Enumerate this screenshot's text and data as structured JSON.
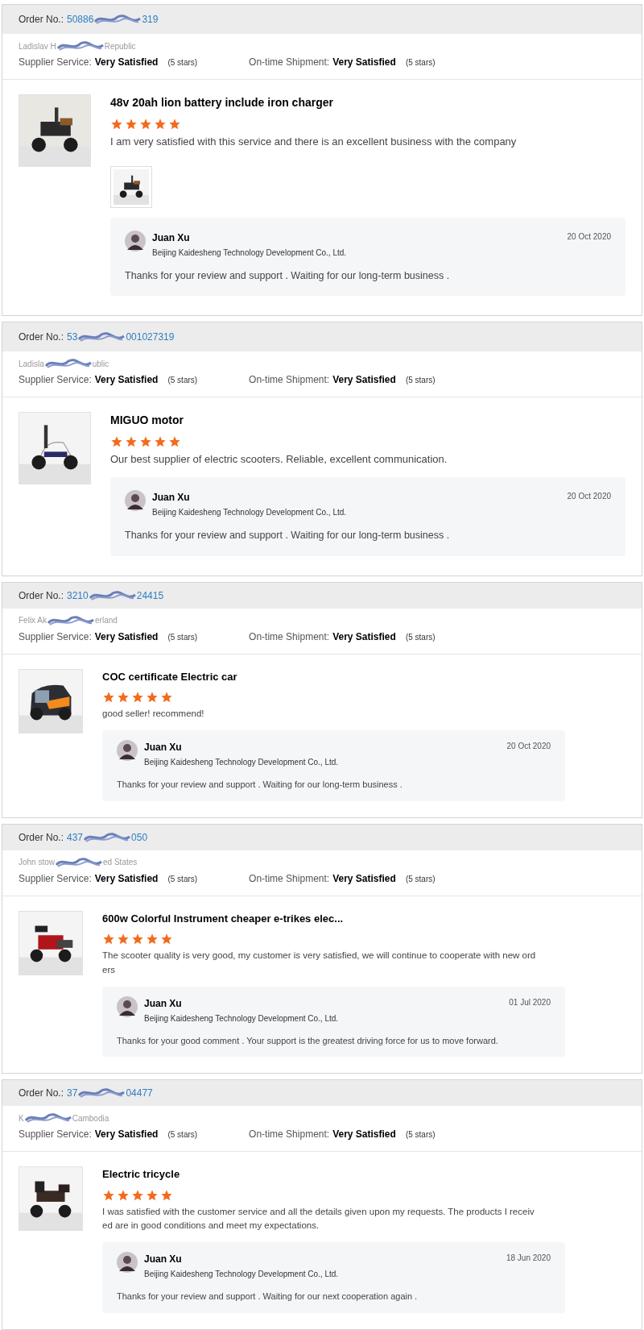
{
  "reviews": [
    {
      "order_label": "Order No.:",
      "order_start": "50886",
      "order_end": "319",
      "reviewer_start": "Ladislav H",
      "reviewer_end": "Republic",
      "supplier_label": "Supplier Service:",
      "supplier_value": "Very Satisfied",
      "supplier_stars": "(5 stars)",
      "shipment_label": "On-time Shipment:",
      "shipment_value": "Very Satisfied",
      "shipment_stars": "(5 stars)",
      "product": "48v 20ah lion battery include iron charger",
      "stars": 5,
      "comment": "I am very satisfied with this service and there is an excellent business with the company",
      "photos": [
        {
          "kind": "picture"
        }
      ],
      "reply": {
        "name": "Juan Xu",
        "company": "Beijing Kaidesheng Technology Development Co., Ltd.",
        "date": "20 Oct 2020",
        "text": "Thanks for your review and support . Waiting for our long-term business ."
      }
    },
    {
      "order_label": "Order No.:",
      "order_start": "53",
      "order_end": "001027319",
      "reviewer_start": "Ladisla",
      "reviewer_end": "ublic",
      "supplier_label": "Supplier Service:",
      "supplier_value": "Very Satisfied",
      "supplier_stars": "(5 stars)",
      "shipment_label": "On-time Shipment:",
      "shipment_value": "Very Satisfied",
      "shipment_stars": "(5 stars)",
      "product": "MIGUO motor",
      "stars": 5,
      "comment": "Our best supplier of electric scooters. Reliable, excellent communication.",
      "reply": {
        "name": "Juan Xu",
        "company": "Beijing Kaidesheng Technology Development Co., Ltd.",
        "date": "20 Oct 2020",
        "text": "Thanks for your review and support . Waiting for our long-term business ."
      }
    },
    {
      "order_label": "Order No.:",
      "order_start": "3210",
      "order_end": "24415",
      "reviewer_start": "Felix Ak",
      "reviewer_end": "erland",
      "supplier_label": "Supplier Service:",
      "supplier_value": "Very Satisfied",
      "supplier_stars": "(5 stars)",
      "shipment_label": "On-time Shipment:",
      "shipment_value": "Very Satisfied",
      "shipment_stars": "(5 stars)",
      "product": "COC certificate Electric car",
      "stars": 5,
      "comment": "good seller! recommend!",
      "reply": {
        "name": "Juan Xu",
        "company": "Beijing Kaidesheng Technology Development Co., Ltd.",
        "date": "20 Oct 2020",
        "text": "Thanks for your review and support . Waiting for our long-term business ."
      }
    },
    {
      "order_label": "Order No.:",
      "order_start": "437",
      "order_end": "050",
      "reviewer_start": "John stow",
      "reviewer_end": "ed States",
      "supplier_label": "Supplier Service:",
      "supplier_value": "Very Satisfied",
      "supplier_stars": "(5 stars)",
      "shipment_label": "On-time Shipment:",
      "shipment_value": "Very Satisfied",
      "shipment_stars": "(5 stars)",
      "product": "600w Colorful Instrument cheaper e-trikes elec...",
      "stars": 5,
      "comment": "The scooter quality is very good, my customer is very satisfied, we will continue to cooperate with new orders",
      "reply": {
        "name": "Juan Xu",
        "company": "Beijing Kaidesheng Technology Development Co., Ltd.",
        "date": "01 Jul 2020",
        "text": "Thanks for your good comment . Your support is the greatest driving force for us to move forward."
      }
    },
    {
      "order_label": "Order No.:",
      "order_start": "37",
      "order_end": "04477",
      "reviewer_start": "K",
      "reviewer_end": "Cambodia",
      "supplier_label": "Supplier Service:",
      "supplier_value": "Very Satisfied",
      "supplier_stars": "(5 stars)",
      "shipment_label": "On-time Shipment:",
      "shipment_value": "Very Satisfied",
      "shipment_stars": "(5 stars)",
      "product": "Electric tricycle",
      "stars": 5,
      "comment": "I was satisfied with the customer service and all the details given upon my requests. The products I received are in good conditions and meet my expectations.",
      "reply": {
        "name": "Juan Xu",
        "company": "Beijing Kaidesheng Technology Development Co., Ltd.",
        "date": "18 Jun 2020",
        "text": "Thanks for your review and support . Waiting for our next cooperation again ."
      }
    }
  ]
}
